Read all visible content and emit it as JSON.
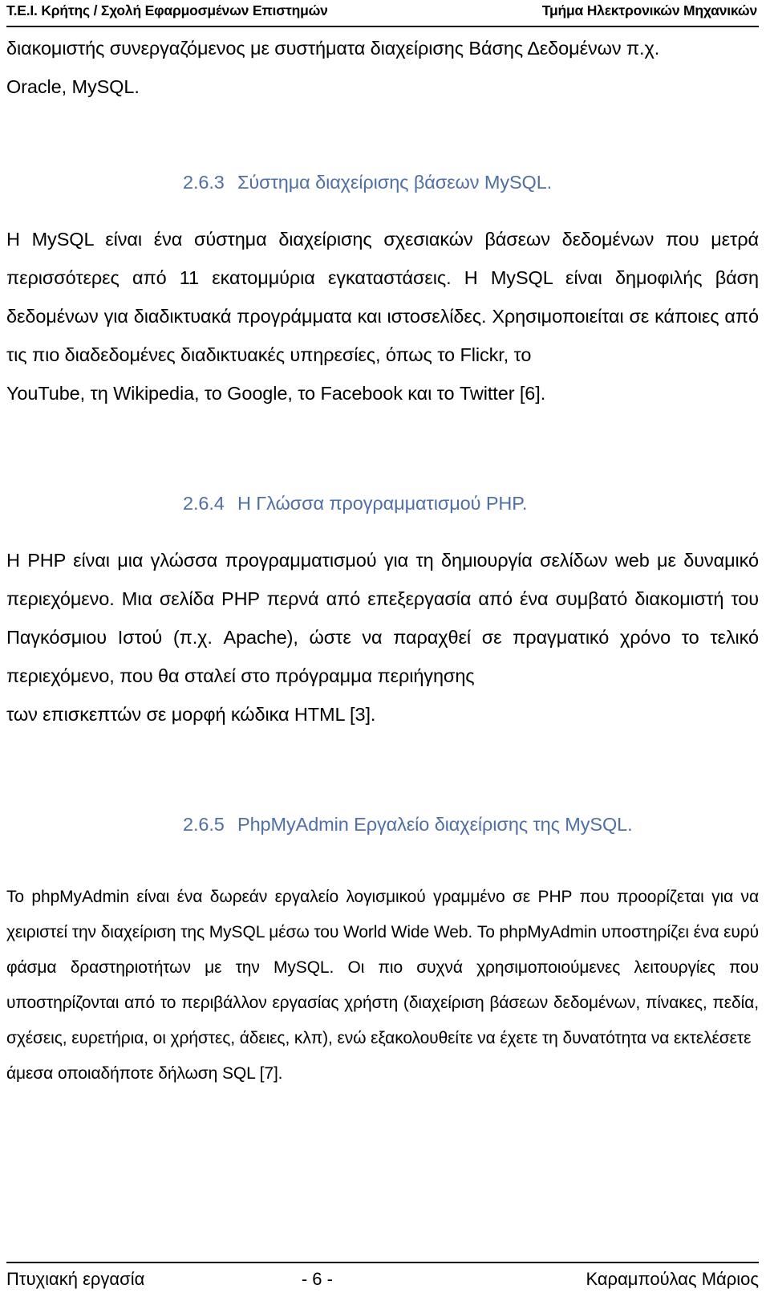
{
  "header": {
    "left": "Τ.Ε.Ι. Κρήτης / Σχολή Εφαρμοσμένων Επιστημών",
    "right": "Τμήμα Ηλεκτρονικών Μηχανικών"
  },
  "colors": {
    "heading": "#4f6fa5",
    "text": "#000000",
    "background": "#ffffff",
    "rule": "#000000"
  },
  "body": {
    "continued_paragraph": "διακομιστής συνεργαζόμενος με συστήματα διαχείρισης Βάσης Δεδομένων π.χ.",
    "continued_paragraph_last_line": "Oracle, MySQL.",
    "section_263": {
      "number": "2.6.3",
      "title": "Σύστημα διαχείρισης βάσεων MySQL.",
      "paragraph": "Η MySQL είναι ένα σύστημα διαχείρισης σχεσιακών βάσεων δεδομένων που μετρά περισσότερες από 11 εκατομμύρια εγκαταστάσεις. Η MySQL είναι δημοφιλής βάση δεδομένων για διαδικτυακά προγράμματα και ιστοσελίδες. Χρησιμοποιείται σε κάποιες από τις πιο διαδεδομένες διαδικτυακές υπηρεσίες, όπως το Flickr, το",
      "paragraph_last_line": "YouTube, τη Wikipedia, το Google, το Facebook  και το Twitter [6]."
    },
    "section_264": {
      "number": "2.6.4",
      "title": "Η Γλώσσα προγραμματισμού PHP.",
      "paragraph": "Η PHP είναι  μια γλώσσα  προγραμματισμού για  τη  δημιουργία  σελίδων  web  με δυναμικό  περιεχόμενο.  Μια  σελίδα  PHP  περνά  από  επεξεργασία  από  ένα συμβατό διακομιστή του  Παγκόσμιου  Ιστού  (π.χ. Apache),  ώστε  να  παραχθεί  σε πραγματικό χρόνο το τελικό περιεχόμενο, που θα σταλεί στο πρόγραμμα περιήγησης",
      "paragraph_last_line": "των επισκεπτών σε μορφή κώδικα HTML [3]."
    },
    "section_265": {
      "number": "2.6.5",
      "title": "PhpMyAdmin Εργαλείο διαχείρισης της MySQL.",
      "paragraph": "Το  phpMyAdmin  είναι  ένα  δωρεάν  εργαλείο  λογισμικού  γραμμένο  σε  PHP  που προορίζεται για να χειριστεί την διαχείριση της MySQL μέσω του World Wide Web. Το phpMyAdmin υποστηρίζει ένα ευρύ φάσμα δραστηριοτήτων με την MySQL. Οι πιο συχνά  χρησιμοποιούμενες  λειτουργίες  που  υποστηρίζονται  από  το  περιβάλλον εργασίας χρήστη (διαχείριση βάσεων δεδομένων, πίνακες, πεδία, σχέσεις, ευρετήρια, οι χρήστες, άδειες, κλπ), ενώ εξακολουθείτε να έχετε τη δυνατότητα να εκτελέσετε",
      "paragraph_last_line": "άμεσα οποιαδήποτε δήλωση SQL [7]."
    }
  },
  "footer": {
    "left": "Πτυχιακή εργασία",
    "center": "- 6 -",
    "right": "Καραμπούλας Μάριος"
  }
}
